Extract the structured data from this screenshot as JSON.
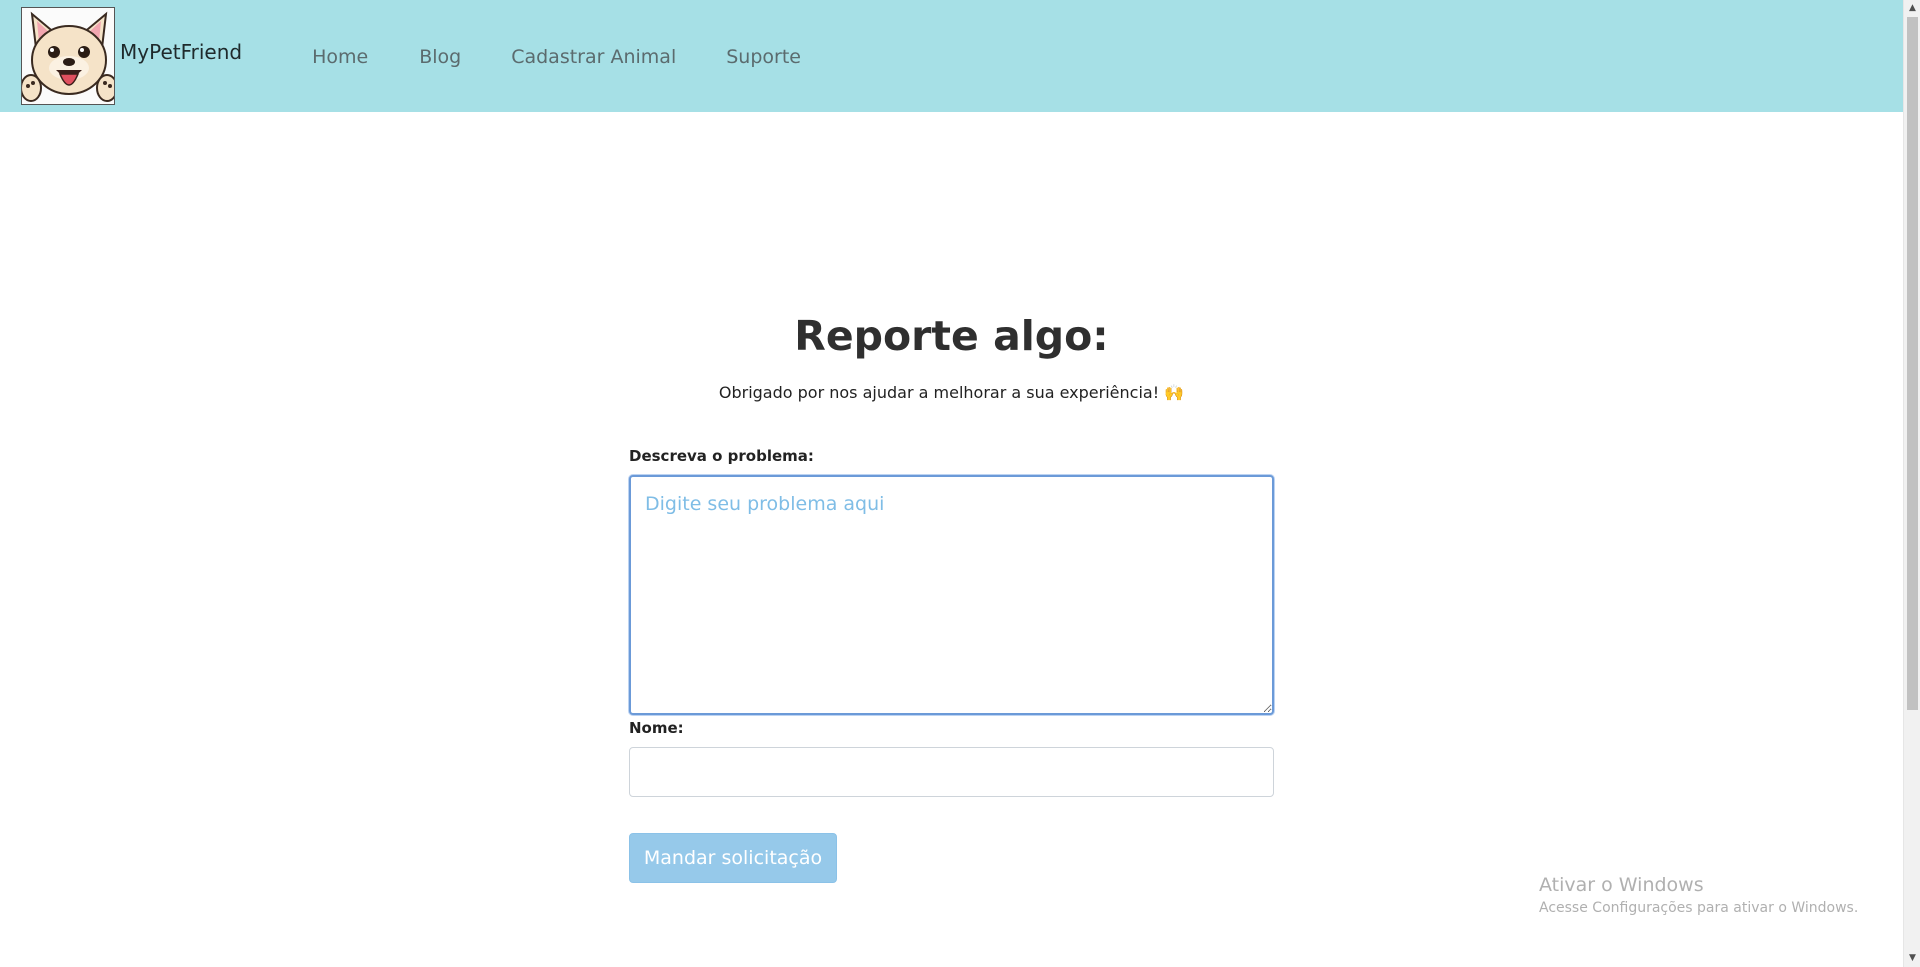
{
  "header": {
    "brand_name": "MyPetFriend",
    "logo_icon": "french-bulldog-logo-icon",
    "nav": [
      {
        "label": "Home"
      },
      {
        "label": "Blog"
      },
      {
        "label": "Cadastrar Animal"
      },
      {
        "label": "Suporte"
      }
    ],
    "background": "#a6e0e6"
  },
  "main": {
    "title": "Reporte algo:",
    "subtitle": "Obrigado por nos ajudar a melhorar a sua experiência! 🙌",
    "form": {
      "problem_label": "Descreva o problema:",
      "problem_placeholder": "Digite seu problema aqui",
      "problem_value": "",
      "name_label": "Nome:",
      "name_value": "",
      "submit_label": "Mandar solicitação"
    }
  },
  "watermark": {
    "title": "Ativar o Windows",
    "subtitle": "Acesse Configurações para ativar o Windows."
  },
  "colors": {
    "accent": "#96c9ea",
    "focus_border": "#6b9ad8",
    "placeholder": "#7fbde6"
  }
}
